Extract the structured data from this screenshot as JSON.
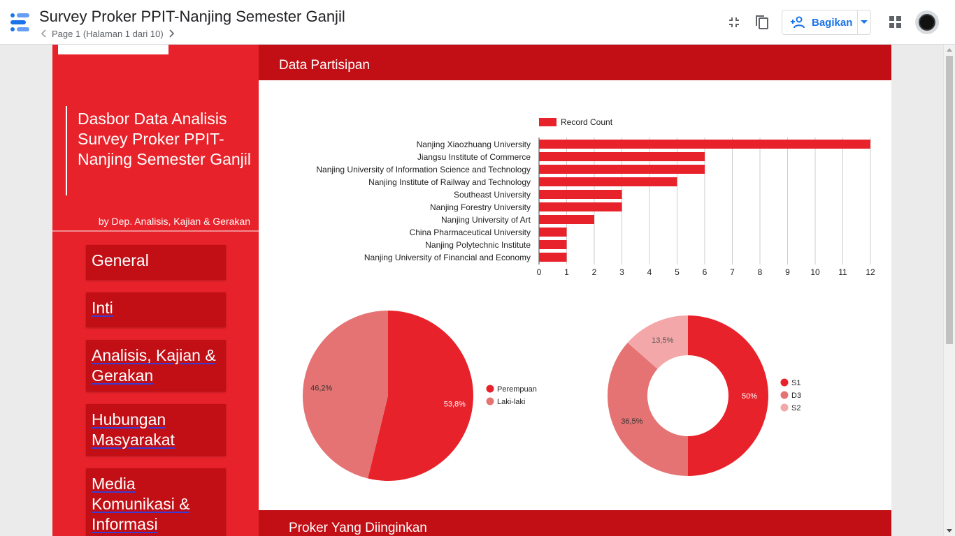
{
  "app": {
    "title": "Survey Proker PPIT-Nanjing Semester Ganjil",
    "page_indicator": "Page 1 (Halaman 1 dari 10)",
    "share_label": "Bagikan",
    "icons": [
      "data-studio-logo-icon",
      "chevron-left-icon",
      "chevron-right-icon",
      "exit-fullscreen-icon",
      "copy-icon",
      "person-add-icon",
      "caret-down-icon",
      "apps-grid-icon",
      "avatar"
    ]
  },
  "sidebar": {
    "title": "Dasbor Data Analisis Survey Proker PPIT-Nanjing Semester Ganjil",
    "byline": "by Dep. Analisis, Kajian & Gerakan",
    "nav": [
      {
        "label": "General"
      },
      {
        "label": "Inti"
      },
      {
        "label": "Analisis, Kajian & Gerakan"
      },
      {
        "label": "Hubungan Masyarakat"
      },
      {
        "label": "Media Komunikasi & Informasi"
      }
    ]
  },
  "sections": {
    "participants": "Data Partisipan",
    "programs": "Proker Yang Diinginkan"
  },
  "colors": {
    "primary_red": "#e8222a",
    "dark_red": "#c10f15",
    "medium_red": "#e57373",
    "light_red": "#f4a7a9"
  },
  "chart_data": [
    {
      "type": "bar",
      "orientation": "horizontal",
      "legend": [
        "Record Count"
      ],
      "legend_position": "top",
      "categories": [
        "Nanjing Xiaozhuang University",
        "Jiangsu Institute of Commerce",
        "Nanjing University of Information Science and Technology",
        "Nanjing Institute of Railway and Technology",
        "Southeast University",
        "Nanjing Forestry University",
        "Nanjing University of Art",
        "China Pharmaceutical University",
        "Nanjing Polytechnic Institute",
        "Nanjing University of Financial and Economy"
      ],
      "series": [
        {
          "name": "Record Count",
          "values": [
            12,
            6,
            6,
            5,
            3,
            3,
            2,
            1,
            1,
            1
          ]
        }
      ],
      "xticks": [
        "0",
        "1",
        "2",
        "3",
        "4",
        "5",
        "6",
        "7",
        "8",
        "9",
        "10",
        "11",
        "12"
      ],
      "xlim": [
        0,
        12
      ],
      "grid": true
    },
    {
      "type": "pie",
      "slices": [
        {
          "label": "Perempuan",
          "value": 53.8,
          "display": "53,8%",
          "color": "#e8222a"
        },
        {
          "label": "Laki-laki",
          "value": 46.2,
          "display": "46,2%",
          "color": "#e57373"
        }
      ],
      "legend_position": "right"
    },
    {
      "type": "pie",
      "style": "donut",
      "slices": [
        {
          "label": "S1",
          "value": 50,
          "display": "50%",
          "color": "#e8222a"
        },
        {
          "label": "D3",
          "value": 36.5,
          "display": "36,5%",
          "color": "#e57373"
        },
        {
          "label": "S2",
          "value": 13.5,
          "display": "13,5%",
          "color": "#f4a7a9"
        }
      ],
      "legend_position": "right"
    }
  ]
}
